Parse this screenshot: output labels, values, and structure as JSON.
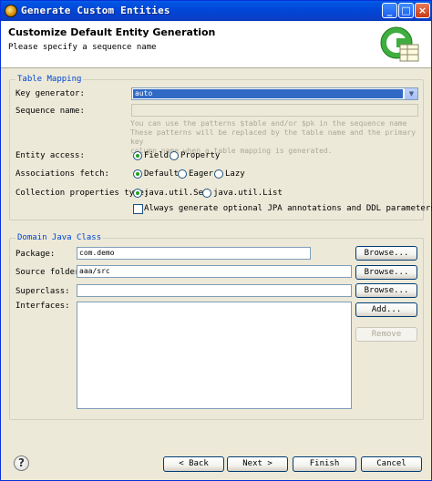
{
  "window": {
    "title": "Generate Custom Entities"
  },
  "banner": {
    "title": "Customize Default Entity Generation",
    "description": "Please specify a sequence name"
  },
  "table_mapping": {
    "legend": "Table Mapping",
    "key_generator_label": "Key generator:",
    "key_generator_value": "auto",
    "sequence_name_label": "Sequence name:",
    "sequence_name_value": "",
    "hint_lines": [
      "You can use the patterns $table and/or $pk in the sequence name",
      "These patterns will be replaced by the table name and the primary key",
      "column name when a table mapping is generated."
    ],
    "entity_access_label": "Entity access:",
    "entity_access_options": [
      "Field",
      "Property"
    ],
    "entity_access_selected": "Field",
    "associations_fetch_label": "Associations fetch:",
    "associations_fetch_options": [
      "Default",
      "Eager",
      "Lazy"
    ],
    "associations_fetch_selected": "Default",
    "collection_type_label": "Collection properties type:",
    "collection_type_options": [
      "java.util.Set",
      "java.util.List"
    ],
    "collection_type_selected": "java.util.Set",
    "optional_jpa_label": "Always generate optional JPA annotations and DDL parameters",
    "optional_jpa_checked": false
  },
  "domain_java_class": {
    "legend": "Domain Java Class",
    "package_label": "Package:",
    "package_value": "com.demo",
    "source_folder_label": "Source folder:",
    "source_folder_value": "aaa/src",
    "superclass_label": "Superclass:",
    "superclass_value": "",
    "interfaces_label": "Interfaces:",
    "browse_label": "Browse...",
    "add_label": "Add...",
    "remove_label": "Remove"
  },
  "footer": {
    "back_label": "< Back",
    "next_label": "Next >",
    "finish_label": "Finish",
    "cancel_label": "Cancel"
  },
  "colors": {
    "title_bar": "#0245d6",
    "group_legend": "#0046d5",
    "selection": "#316ac5",
    "dialog_bg": "#ece9d8"
  }
}
